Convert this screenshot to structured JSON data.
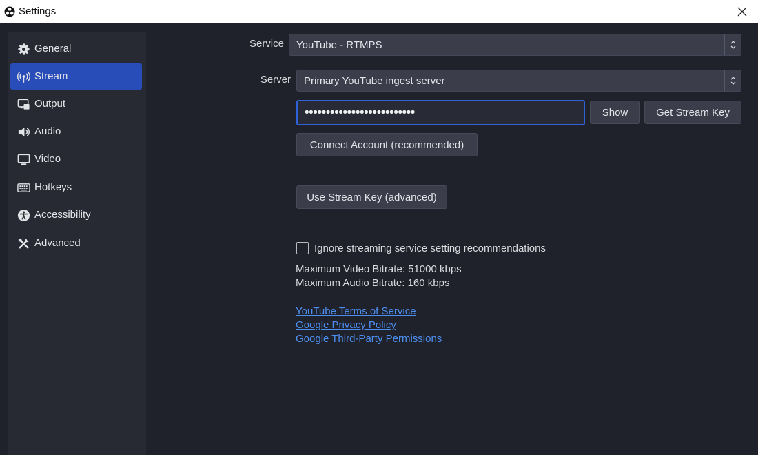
{
  "window": {
    "title": "Settings"
  },
  "sidebar": {
    "items": [
      {
        "label": "General",
        "icon": "gear-icon"
      },
      {
        "label": "Stream",
        "icon": "broadcast-antenna-icon",
        "active": true
      },
      {
        "label": "Output",
        "icon": "output-monitor-icon"
      },
      {
        "label": "Audio",
        "icon": "speaker-icon"
      },
      {
        "label": "Video",
        "icon": "monitor-icon"
      },
      {
        "label": "Hotkeys",
        "icon": "keyboard-icon"
      },
      {
        "label": "Accessibility",
        "icon": "accessibility-icon"
      },
      {
        "label": "Advanced",
        "icon": "tools-icon"
      }
    ]
  },
  "stream": {
    "service_label": "Service",
    "service_value": "YouTube - RTMPS",
    "server_label": "Server",
    "server_value": "Primary YouTube ingest server",
    "stream_key_masked": "••••••••••••••••••••••••••",
    "show_button": "Show",
    "get_stream_key_button": "Get Stream Key",
    "connect_account_button": "Connect Account (recommended)",
    "use_stream_key_button": "Use Stream Key (advanced)",
    "ignore_recommendations_label": "Ignore streaming service setting recommendations",
    "ignore_recommendations_checked": false,
    "max_video_bitrate": "Maximum Video Bitrate: 51000 kbps",
    "max_audio_bitrate": "Maximum Audio Bitrate: 160 kbps",
    "links": [
      "YouTube Terms of Service",
      "Google Privacy Policy",
      "Google Third-Party Permissions"
    ]
  },
  "colors": {
    "background": "#1f212b",
    "sidebar": "#272a33",
    "accent": "#284cb8",
    "focus_border": "#2f62d9",
    "link": "#4d8ff0"
  }
}
